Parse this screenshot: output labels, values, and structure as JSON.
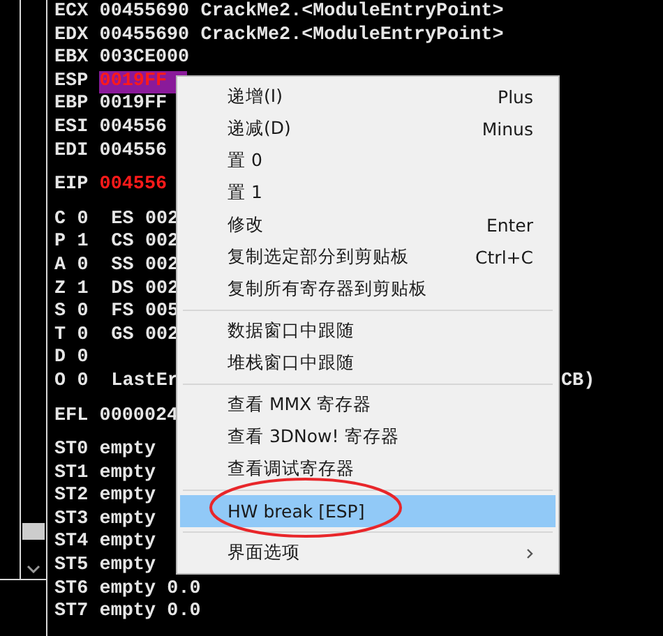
{
  "register_groups": [
    {
      "lines": [
        {
          "kind": "register",
          "name": "ECX",
          "value": "00455690",
          "comment": "CrackMe2.<ModuleEntryPoint>",
          "changed": false,
          "selected": false
        },
        {
          "kind": "register",
          "name": "EDX",
          "value": "00455690",
          "comment": "CrackMe2.<ModuleEntryPoint>",
          "changed": false,
          "selected": false
        },
        {
          "kind": "register",
          "name": "EBX",
          "value": "003CE000",
          "changed": false,
          "selected": false
        },
        {
          "kind": "register",
          "name": "ESP",
          "value": "0019FF",
          "changed": true,
          "selected": true
        },
        {
          "kind": "register",
          "name": "EBP",
          "value": "0019FF",
          "changed": false,
          "selected": false
        },
        {
          "kind": "register",
          "name": "ESI",
          "value": "004556",
          "changed": false,
          "selected": false
        },
        {
          "kind": "register",
          "name": "EDI",
          "value": "004556",
          "changed": false,
          "selected": false
        }
      ]
    },
    {
      "lines": [
        {
          "kind": "register",
          "name": "EIP",
          "value": "004556",
          "changed": true,
          "selected": false
        }
      ]
    },
    {
      "lines": [
        {
          "kind": "flag",
          "flag": "C",
          "bit": "0",
          "segment": "ES",
          "segment_value": "002"
        },
        {
          "kind": "flag",
          "flag": "P",
          "bit": "1",
          "segment": "CS",
          "segment_value": "002"
        },
        {
          "kind": "flag",
          "flag": "A",
          "bit": "0",
          "segment": "SS",
          "segment_value": "002"
        },
        {
          "kind": "flag",
          "flag": "Z",
          "bit": "1",
          "segment": "DS",
          "segment_value": "002"
        },
        {
          "kind": "flag",
          "flag": "S",
          "bit": "0",
          "segment": "FS",
          "segment_value": "005"
        },
        {
          "kind": "flag",
          "flag": "T",
          "bit": "0",
          "segment": "GS",
          "segment_value": "002"
        },
        {
          "kind": "flag",
          "flag": "D",
          "bit": "0"
        },
        {
          "kind": "flag",
          "flag": "O",
          "bit": "0",
          "segment": "LastEr",
          "tail": "CB)"
        }
      ]
    },
    {
      "lines": [
        {
          "kind": "register",
          "name": "EFL",
          "value": "0000024",
          "changed": false,
          "selected": false
        }
      ]
    },
    {
      "lines": [
        {
          "kind": "register",
          "name": "ST0",
          "value": "empty",
          "changed": false,
          "selected": false
        },
        {
          "kind": "register",
          "name": "ST1",
          "value": "empty",
          "changed": false,
          "selected": false
        },
        {
          "kind": "register",
          "name": "ST2",
          "value": "empty",
          "changed": false,
          "selected": false
        },
        {
          "kind": "register",
          "name": "ST3",
          "value": "empty",
          "changed": false,
          "selected": false
        },
        {
          "kind": "register",
          "name": "ST4",
          "value": "empty",
          "changed": false,
          "selected": false
        },
        {
          "kind": "register",
          "name": "ST5",
          "value": "empty",
          "changed": false,
          "selected": false
        },
        {
          "kind": "register",
          "name": "ST6",
          "value": "empty",
          "comment": "0.0",
          "changed": false,
          "selected": false
        },
        {
          "kind": "register",
          "name": "ST7",
          "value": "empty",
          "comment": "0.0",
          "changed": false,
          "selected": false
        }
      ]
    }
  ],
  "context_menu": [
    {
      "kind": "item",
      "label": "递增(I)",
      "shortcut": "Plus",
      "selected": false
    },
    {
      "kind": "item",
      "label": "递减(D)",
      "shortcut": "Minus",
      "selected": false
    },
    {
      "kind": "item",
      "label": "置 0",
      "selected": false
    },
    {
      "kind": "item",
      "label": "置 1",
      "selected": false
    },
    {
      "kind": "item",
      "label": "修改",
      "shortcut": "Enter",
      "selected": false
    },
    {
      "kind": "item",
      "label": "复制选定部分到剪贴板",
      "shortcut": "Ctrl+C",
      "selected": false
    },
    {
      "kind": "item",
      "label": "复制所有寄存器到剪贴板",
      "selected": false
    },
    {
      "kind": "separator"
    },
    {
      "kind": "item",
      "label": "数据窗口中跟随",
      "selected": false
    },
    {
      "kind": "item",
      "label": "堆栈窗口中跟随",
      "selected": false
    },
    {
      "kind": "separator"
    },
    {
      "kind": "item",
      "label": "查看 MMX 寄存器",
      "selected": false
    },
    {
      "kind": "item",
      "label": "查看 3DNow! 寄存器",
      "selected": false
    },
    {
      "kind": "item",
      "label": "查看调试寄存器",
      "selected": false
    },
    {
      "kind": "separator"
    },
    {
      "kind": "item",
      "label": "HW break [ESP]",
      "selected": true,
      "circled": true
    },
    {
      "kind": "separator"
    },
    {
      "kind": "item",
      "label": "界面选项",
      "selected": false,
      "submenu": true
    }
  ]
}
